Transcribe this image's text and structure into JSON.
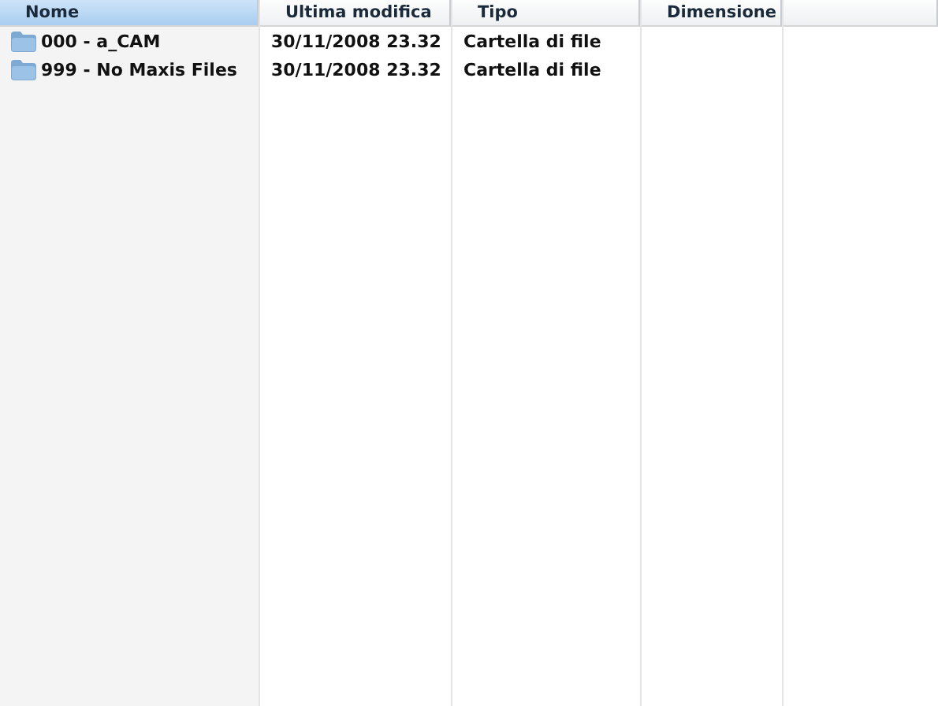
{
  "table": {
    "columns": [
      {
        "label": "Nome",
        "sorted": true
      },
      {
        "label": "Ultima modifica",
        "sorted": false
      },
      {
        "label": "Tipo",
        "sorted": false
      },
      {
        "label": "Dimensione",
        "sorted": false
      }
    ],
    "rows": [
      {
        "name": "000 -  a_CAM",
        "modified": "30/11/2008 23.32",
        "type": "Cartella di file"
      },
      {
        "name": "999 -  No Maxis Files",
        "modified": "30/11/2008 23.32",
        "type": "Cartella di file"
      }
    ]
  }
}
